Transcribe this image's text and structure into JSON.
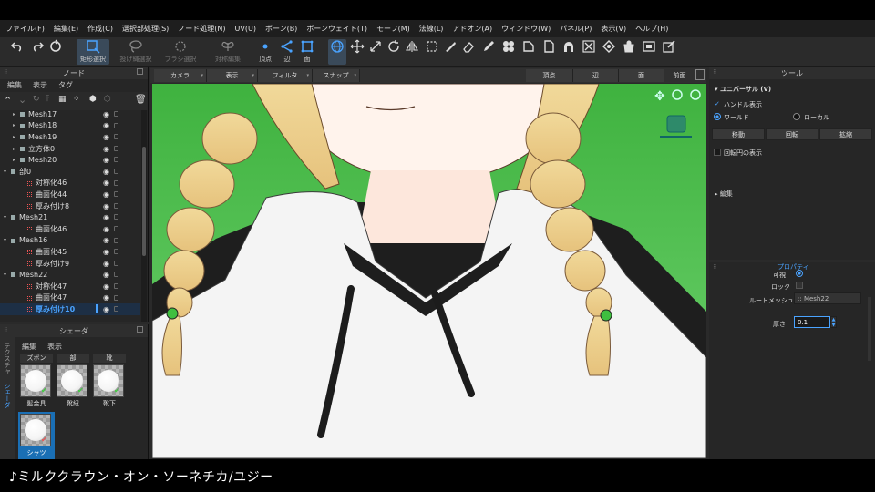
{
  "menubar": {
    "items": [
      "ファイル(F)",
      "編集(E)",
      "作成(C)",
      "選択部処理(S)",
      "ノード処理(N)",
      "UV(U)",
      "ボーン(B)",
      "ボーンウェイト(T)",
      "モーフ(M)",
      "法線(L)",
      "アドオン(A)",
      "ウィンドウ(W)",
      "パネル(P)",
      "表示(V)",
      "ヘルプ(H)"
    ]
  },
  "toolbar": {
    "rect_select": "矩形選択",
    "lasso_select": "投げ縄選択",
    "brush_select": "ブラシ選択",
    "symmetric_edit": "対称編集",
    "vertex": "頂点",
    "edge": "辺",
    "face": "面"
  },
  "node_panel": {
    "title": "ノード",
    "tabs": [
      "編集",
      "表示",
      "タグ"
    ],
    "rows": [
      {
        "name": "Mesh17",
        "level": 1,
        "type": "mesh",
        "expand": "▸"
      },
      {
        "name": "Mesh18",
        "level": 1,
        "type": "mesh",
        "expand": "▸"
      },
      {
        "name": "Mesh19",
        "level": 1,
        "type": "mesh",
        "expand": "▸"
      },
      {
        "name": "立方体0",
        "level": 1,
        "type": "mesh",
        "expand": "▸"
      },
      {
        "name": "Mesh20",
        "level": 1,
        "type": "mesh",
        "expand": "▸"
      },
      {
        "name": "部0",
        "level": 0,
        "type": "mesh",
        "expand": "▾"
      },
      {
        "name": "対称化46",
        "level": 2,
        "type": "mod",
        "expand": ""
      },
      {
        "name": "曲面化44",
        "level": 2,
        "type": "mod",
        "expand": ""
      },
      {
        "name": "厚み付け8",
        "level": 2,
        "type": "mod",
        "expand": ""
      },
      {
        "name": "Mesh21",
        "level": 0,
        "type": "mesh",
        "expand": "▾"
      },
      {
        "name": "曲面化46",
        "level": 2,
        "type": "mod",
        "expand": ""
      },
      {
        "name": "Mesh16",
        "level": 0,
        "type": "mesh",
        "expand": "▾"
      },
      {
        "name": "曲面化45",
        "level": 2,
        "type": "mod",
        "expand": ""
      },
      {
        "name": "厚み付け9",
        "level": 2,
        "type": "mod",
        "expand": ""
      },
      {
        "name": "Mesh22",
        "level": 0,
        "type": "mesh",
        "expand": "▾"
      },
      {
        "name": "対称化47",
        "level": 2,
        "type": "mod",
        "expand": ""
      },
      {
        "name": "曲面化47",
        "level": 2,
        "type": "mod",
        "expand": ""
      },
      {
        "name": "厚み付け10",
        "level": 2,
        "type": "mod",
        "expand": "",
        "selected": true
      }
    ]
  },
  "shader_panel": {
    "title": "シェーダ",
    "tabs": [
      "編集",
      "表示"
    ],
    "vertical_tabs": [
      "テクスチャ",
      "シェーダ"
    ],
    "headers": [
      "ズボン",
      "部",
      "靴"
    ],
    "items": [
      "髪金具",
      "靴紐",
      "靴下",
      "シャツ"
    ]
  },
  "viewport": {
    "tabs": [
      "カメラ",
      "表示",
      "フィルタ",
      "スナップ"
    ],
    "modes": [
      "頂点",
      "辺",
      "面",
      "前面"
    ]
  },
  "tool_panel": {
    "title": "ツール",
    "section": "ユニバーサル (V)",
    "handle_display": "ハンドル表示",
    "world": "ワールド",
    "local": "ローカル",
    "move": "移動",
    "rotate": "回転",
    "scale": "拡縮",
    "show_rotation_circle": "回転円の表示",
    "edit": "編集"
  },
  "property_panel": {
    "title": "プロパティ",
    "visible_label": "可視",
    "lock_label": "ロック",
    "root_mesh_label": "ルートメッシュ",
    "root_mesh_value": ":: Mesh22",
    "thickness_label": "厚さ",
    "thickness_value": "0.1"
  },
  "subtitle": "♪ミルククラウン・オン・ソーネチカ/ユジー",
  "colors": {
    "accent": "#4aa3ff",
    "viewport_bg": "#4cbf4c",
    "selected_shader": "#1a6fb5"
  }
}
